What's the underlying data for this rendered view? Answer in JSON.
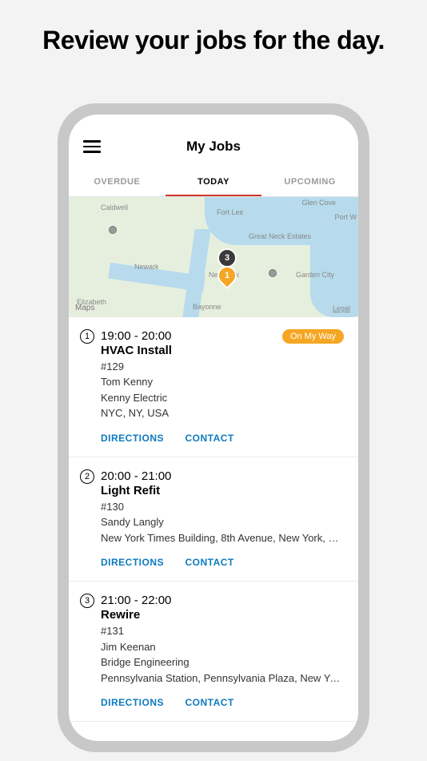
{
  "promo_title": "Review your jobs for the day.",
  "header": {
    "title": "My Jobs"
  },
  "tabs": [
    {
      "label": "OVERDUE",
      "active": false
    },
    {
      "label": "TODAY",
      "active": true
    },
    {
      "label": "UPCOMING",
      "active": false
    }
  ],
  "map": {
    "provider": "Maps",
    "legal": "Legal",
    "pins": [
      {
        "label": "3",
        "type": "dark"
      },
      {
        "label": "1",
        "type": "orange"
      }
    ],
    "visible_places": [
      "Caldwell",
      "Fort Lee",
      "Glen Cove",
      "Port W",
      "Great Neck Estates",
      "Newark",
      "Garden City",
      "New York",
      "Elizabeth",
      "Bayonne"
    ]
  },
  "action_labels": {
    "directions": "DIRECTIONS",
    "contact": "CONTACT"
  },
  "jobs": [
    {
      "num": "1",
      "time": "19:00 - 20:00",
      "title": "HVAC Install",
      "ref": "#129",
      "person": "Tom Kenny",
      "company": "Kenny Electric",
      "address": "NYC, NY, USA",
      "status": "On My Way"
    },
    {
      "num": "2",
      "time": "20:00 - 21:00",
      "title": "Light Refit",
      "ref": "#130",
      "person": "Sandy Langly",
      "company": "",
      "address": "New York Times Building, 8th Avenue, New York, NY,...",
      "status": ""
    },
    {
      "num": "3",
      "time": "21:00 - 22:00",
      "title": "Rewire",
      "ref": "#131",
      "person": "Jim Keenan",
      "company": "Bridge Engineering",
      "address": "Pennsylvania Station, Pennsylvania Plaza, New York,...",
      "status": ""
    }
  ]
}
